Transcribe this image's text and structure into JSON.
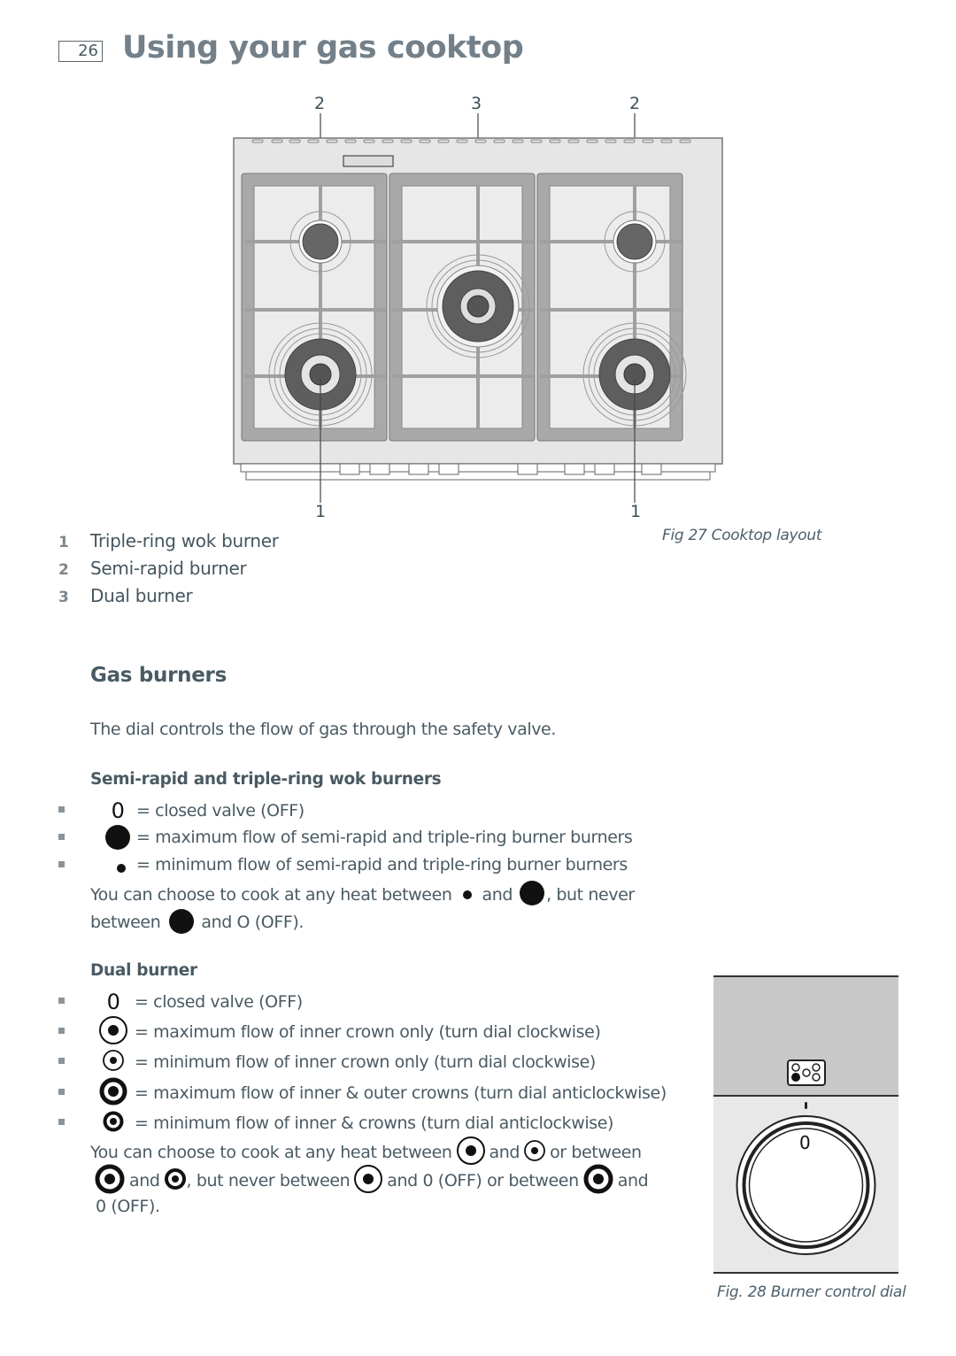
{
  "header": {
    "page_number": "26",
    "title": "Using your gas cooktop"
  },
  "figure27": {
    "callouts_top": [
      "2",
      "3",
      "2"
    ],
    "callouts_bottom": [
      "1",
      "1"
    ],
    "caption": "Fig 27 Cooktop layout",
    "legend": [
      {
        "num": "1",
        "label": "Triple-ring wok burner"
      },
      {
        "num": "2",
        "label": "Semi-rapid burner"
      },
      {
        "num": "3",
        "label": "Dual burner"
      }
    ]
  },
  "gas_burners": {
    "heading": "Gas burners",
    "intro": "The dial controls the flow of gas through the safety valve.",
    "semi_rapid": {
      "heading": "Semi-rapid and triple-ring wok burners",
      "items": [
        {
          "icon": "off-zero-icon",
          "text": "= closed valve (OFF)"
        },
        {
          "icon": "large-flame-dot-icon",
          "text": "= maximum flow of semi-rapid and triple-ring burner burners"
        },
        {
          "icon": "small-flame-dot-icon",
          "text": "= minimum flow of semi-rapid and triple-ring burner burners"
        }
      ],
      "note_parts": [
        "You can choose to cook at any heat between",
        "and",
        ", but never",
        "between",
        "and O (OFF)."
      ]
    },
    "dual": {
      "heading": "Dual burner",
      "items": [
        {
          "icon": "off-zero-icon",
          "text": "= closed valve (OFF)"
        },
        {
          "icon": "inner-crown-max-icon",
          "text": "= maximum flow of inner crown only (turn dial clockwise)"
        },
        {
          "icon": "inner-crown-min-icon",
          "text": "= minimum flow of inner crown only (turn dial clockwise)"
        },
        {
          "icon": "dual-crown-max-icon",
          "text": "= maximum flow of inner & outer crowns (turn dial anticlockwise)"
        },
        {
          "icon": "dual-crown-min-icon",
          "text": "= minimum flow of inner & crowns (turn dial anticlockwise)"
        }
      ],
      "note_parts": [
        "You can choose to cook at any heat between",
        "and",
        "or between",
        "and",
        ", but never between",
        "and 0 (OFF) or between",
        "and",
        "0 (OFF)."
      ]
    }
  },
  "figure28": {
    "dial_marking": "0",
    "caption": "Fig. 28 Burner control dial"
  },
  "symbols": {
    "off": "0"
  }
}
